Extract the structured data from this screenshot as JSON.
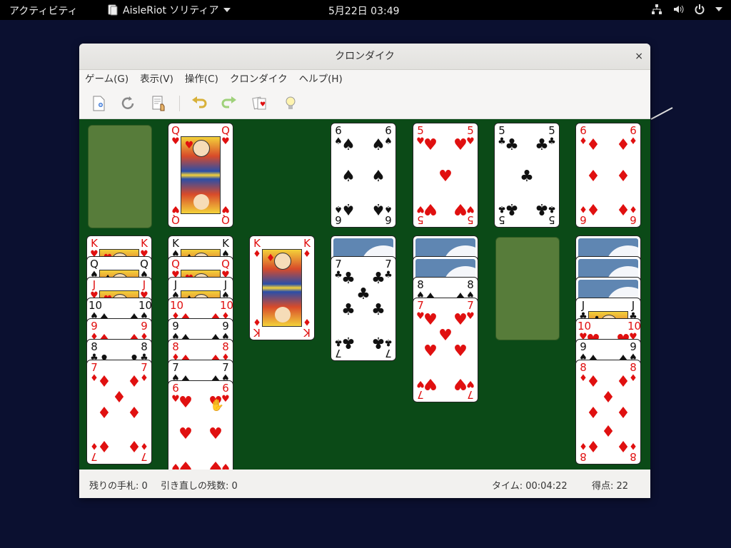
{
  "topbar": {
    "activities": "アクティビティ",
    "app_name": "AisleRiot ソリティア",
    "clock": "5月22日  03:49"
  },
  "window": {
    "title": "クロンダイク",
    "close_glyph": "×"
  },
  "menubar": {
    "items": [
      "ゲーム(G)",
      "表示(V)",
      "操作(C)",
      "クロンダイク",
      "ヘルプ(H)"
    ]
  },
  "toolbar": {
    "icons": [
      "new-game-icon",
      "restart-icon",
      "deal-icon",
      "undo-icon",
      "redo-icon",
      "hint-cards-icon",
      "hint-bulb-icon"
    ]
  },
  "table": {
    "stock": "empty",
    "waste": {
      "rank": "Q",
      "suit": "♥",
      "color": "red"
    },
    "foundations": [
      {
        "rank": "6",
        "suit": "♠",
        "color": "black"
      },
      {
        "rank": "5",
        "suit": "♥",
        "color": "red"
      },
      {
        "rank": "5",
        "suit": "♣",
        "color": "black"
      },
      {
        "rank": "6",
        "suit": "♦",
        "color": "red"
      }
    ],
    "tableau": [
      {
        "face_down": 0,
        "cards": [
          [
            "K",
            "♥"
          ],
          [
            "Q",
            "♠"
          ],
          [
            "J",
            "♥"
          ],
          [
            "10",
            "♠"
          ],
          [
            "9",
            "♦"
          ],
          [
            "8",
            "♣"
          ],
          [
            "7",
            "♦"
          ]
        ]
      },
      {
        "face_down": 0,
        "cards": [
          [
            "K",
            "♠"
          ],
          [
            "Q",
            "♥"
          ],
          [
            "J",
            "♠"
          ],
          [
            "10",
            "♦"
          ],
          [
            "9",
            "♠"
          ],
          [
            "8",
            "♦"
          ],
          [
            "7",
            "♠"
          ],
          [
            "6",
            "♥"
          ]
        ]
      },
      {
        "face_down": 0,
        "cards": [
          [
            "K",
            "♦"
          ]
        ]
      },
      {
        "face_down": 1,
        "cards": [
          [
            "7",
            "♣"
          ]
        ]
      },
      {
        "face_down": 2,
        "cards": [
          [
            "8",
            "♠"
          ],
          [
            "7",
            "♥"
          ]
        ]
      },
      {
        "face_down": 0,
        "cards": []
      },
      {
        "face_down": 3,
        "cards": [
          [
            "J",
            "♣"
          ],
          [
            "10",
            "♥"
          ],
          [
            "9",
            "♠"
          ],
          [
            "8",
            "♦"
          ]
        ]
      }
    ]
  },
  "statusbar": {
    "stock_left": "残りの手札: 0",
    "redeals_left": "引き直しの残数: 0",
    "time": "タイム:  00:04:22",
    "score": "得点:   22"
  },
  "colors": {
    "felt": "#0b4a17",
    "slot": "#577c3a",
    "red_suit": "#e01010",
    "card_back": "#5f86b2"
  }
}
